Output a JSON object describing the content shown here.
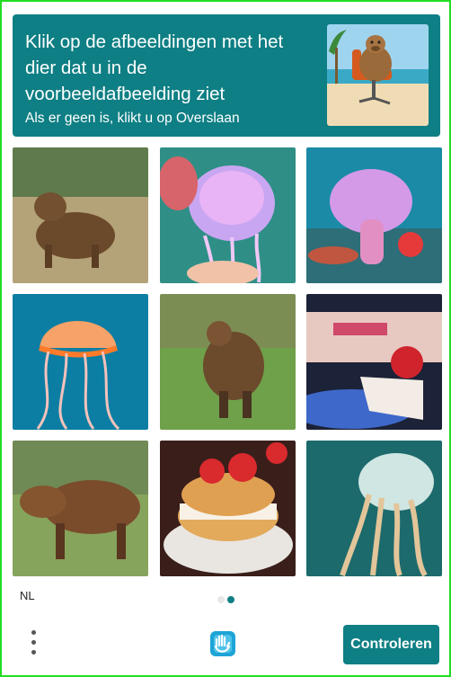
{
  "header": {
    "title": "Klik op de afbeeldingen met het dier dat u in de voorbeeldafbeelding ziet",
    "subtitle": "Als er geen is, klikt u op Overslaan",
    "example_image": "capybara-in-office-chair-on-beach"
  },
  "grid": {
    "tiles": [
      {
        "subject": "capybara"
      },
      {
        "subject": "jellyfish"
      },
      {
        "subject": "jellyfish"
      },
      {
        "subject": "jellyfish"
      },
      {
        "subject": "capybara"
      },
      {
        "subject": "strawberry-cake"
      },
      {
        "subject": "capybara"
      },
      {
        "subject": "strawberry-shortcake"
      },
      {
        "subject": "jellyfish"
      }
    ]
  },
  "footer": {
    "language": "NL",
    "pagination": {
      "total": 2,
      "current": 2
    },
    "submit_label": "Controleren",
    "menu_icon": "more-vertical-icon",
    "brand_icon": "hcaptcha-hand-icon"
  },
  "colors": {
    "accent": "#0e7f84",
    "frame": "#22dd22"
  }
}
